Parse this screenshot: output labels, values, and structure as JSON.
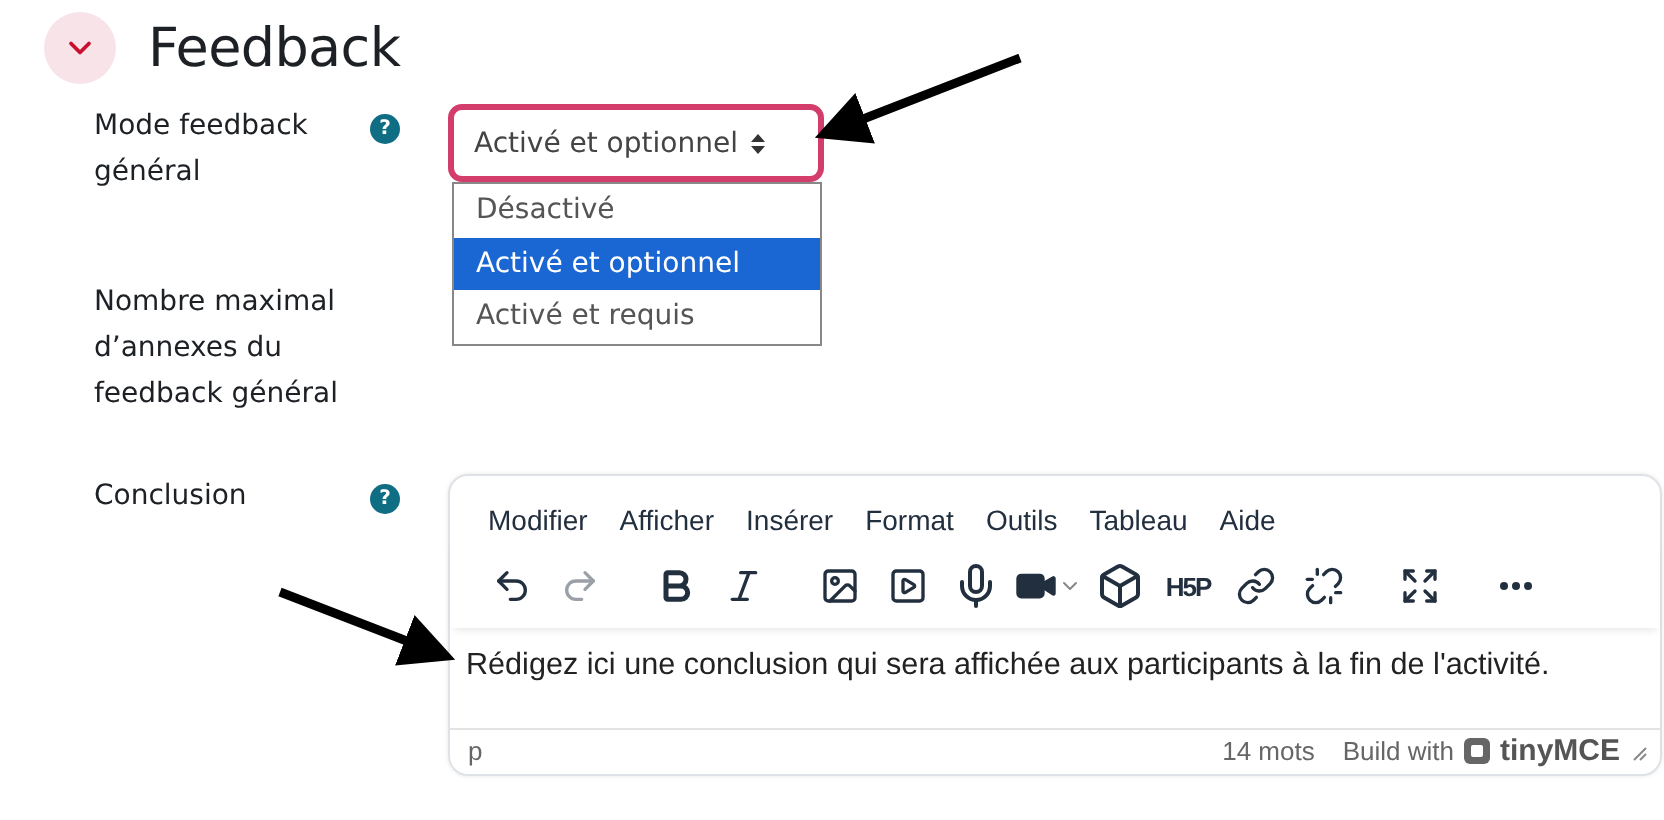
{
  "section": {
    "title": "Feedback",
    "expanded": true
  },
  "fields": [
    {
      "kind": "select",
      "label": "Mode feedback général",
      "help": "?",
      "value": "Activé et optionnel",
      "open": true,
      "options": [
        {
          "label": "Désactivé",
          "selected": false
        },
        {
          "label": "Activé et optionnel",
          "selected": true
        },
        {
          "label": "Activé et requis",
          "selected": false
        }
      ]
    },
    {
      "kind": "empty",
      "label": "Nombre maximal d’annexes du feedback général"
    },
    {
      "kind": "editor",
      "label": "Conclusion",
      "help": "?",
      "editor": {
        "menu": [
          "Modifier",
          "Afficher",
          "Insérer",
          "Format",
          "Outils",
          "Tableau",
          "Aide"
        ],
        "toolbar": [
          {
            "kind": "undo",
            "disabled": false
          },
          {
            "kind": "redo",
            "disabled": true
          },
          {
            "kind": "gap"
          },
          {
            "kind": "bold",
            "disabled": false
          },
          {
            "kind": "italic",
            "disabled": false
          },
          {
            "kind": "gap"
          },
          {
            "kind": "image",
            "disabled": false
          },
          {
            "kind": "media",
            "disabled": false
          },
          {
            "kind": "mic",
            "disabled": false
          },
          {
            "kind": "video",
            "disabled": false
          },
          {
            "kind": "brick",
            "disabled": false
          },
          {
            "kind": "text",
            "label": "H5P",
            "disabled": false
          },
          {
            "kind": "link",
            "disabled": false
          },
          {
            "kind": "unlink",
            "disabled": false
          },
          {
            "kind": "gap"
          },
          {
            "kind": "fullscreen",
            "disabled": false
          },
          {
            "kind": "gap"
          },
          {
            "kind": "more",
            "disabled": false
          }
        ],
        "content": "Rédigez ici une conclusion qui sera affichée aux participants à la fin de l'activité.",
        "path": "p",
        "word_count": "14 mots",
        "branding": "Build with",
        "brand": "tinyMCE"
      }
    }
  ]
}
